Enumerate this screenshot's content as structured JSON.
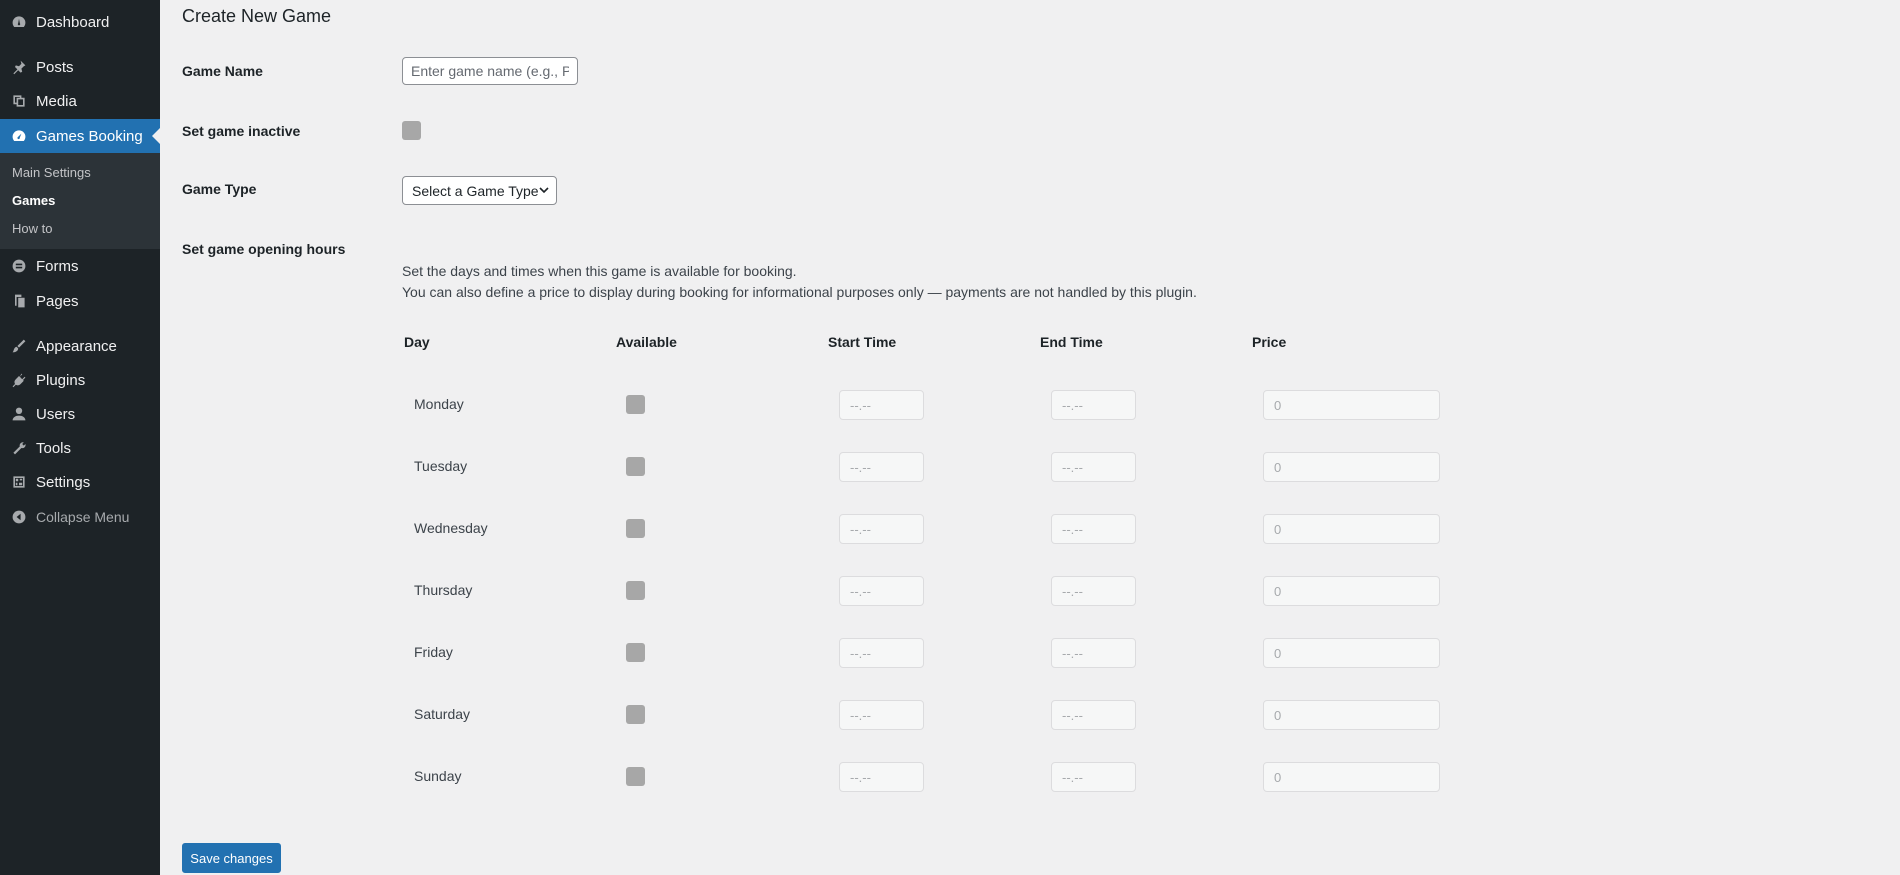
{
  "sidebar": {
    "items": [
      {
        "label": "Dashboard",
        "icon": "dashboard-icon"
      },
      {
        "label": "Posts",
        "icon": "pin-icon"
      },
      {
        "label": "Media",
        "icon": "media-icon"
      },
      {
        "label": "Games Booking",
        "icon": "gauge-icon",
        "active": true
      },
      {
        "label": "Forms",
        "icon": "forms-icon"
      },
      {
        "label": "Pages",
        "icon": "pages-icon"
      },
      {
        "label": "Appearance",
        "icon": "brush-icon"
      },
      {
        "label": "Plugins",
        "icon": "plugin-icon"
      },
      {
        "label": "Users",
        "icon": "user-icon"
      },
      {
        "label": "Tools",
        "icon": "wrench-icon"
      },
      {
        "label": "Settings",
        "icon": "settings-icon"
      }
    ],
    "submenu": [
      {
        "label": "Main Settings"
      },
      {
        "label": "Games",
        "current": true
      },
      {
        "label": "How to"
      }
    ],
    "collapse_label": "Collapse Menu",
    "accent_color": "#2271b1"
  },
  "page": {
    "title": "Create New Game",
    "game_name_label": "Game Name",
    "game_name_placeholder": "Enter game name (e.g., Pi",
    "inactive_label": "Set game inactive",
    "game_type_label": "Game Type",
    "game_type_value": "Select a Game Type",
    "hours_label": "Set game opening hours",
    "hours_desc_1": "Set the days and times when this game is available for booking.",
    "hours_desc_2": "You can also define a price to display during booking for informational purposes only — payments are not handled by this plugin.",
    "save_label": "Save changes"
  },
  "schedule": {
    "headers": {
      "day": "Day",
      "available": "Available",
      "start": "Start Time",
      "end": "End Time",
      "price": "Price"
    },
    "time_placeholder": "--.--",
    "price_placeholder": "0",
    "days": [
      {
        "name": "Monday"
      },
      {
        "name": "Tuesday"
      },
      {
        "name": "Wednesday"
      },
      {
        "name": "Thursday"
      },
      {
        "name": "Friday"
      },
      {
        "name": "Saturday"
      },
      {
        "name": "Sunday"
      }
    ]
  }
}
